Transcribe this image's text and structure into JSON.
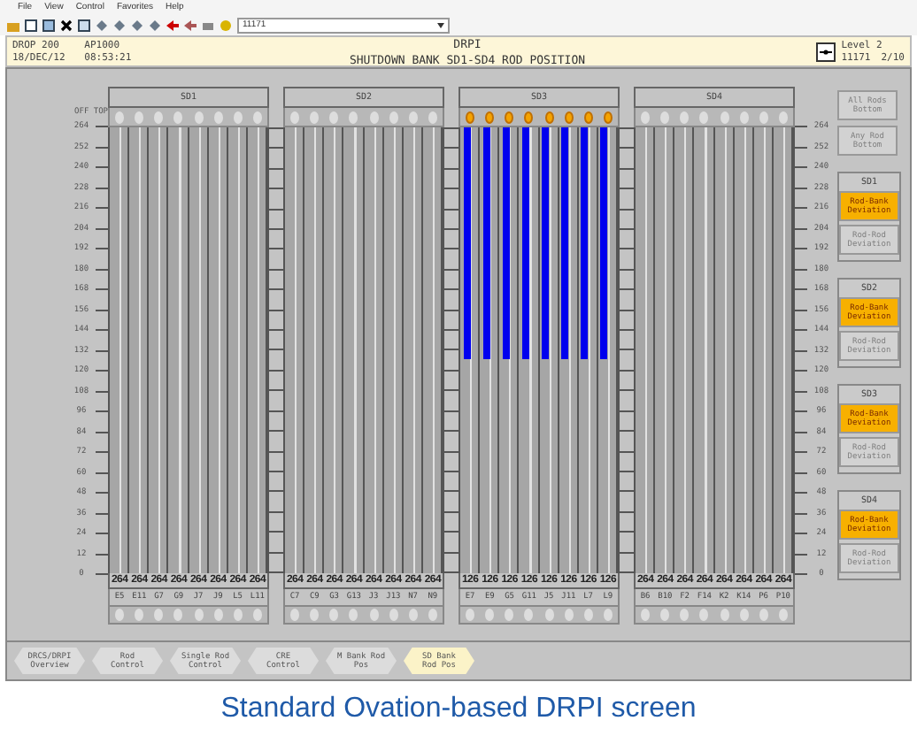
{
  "menu": [
    "File",
    "View",
    "Control",
    "Favorites",
    "Help"
  ],
  "toolbar": {
    "field_value": "11171"
  },
  "header": {
    "drop": "DROP 200",
    "node": "AP1000",
    "date": "18/DEC/12",
    "time": "08:53:21",
    "title": "DRPI",
    "subtitle": "SHUTDOWN BANK SD1-SD4 ROD POSITION",
    "level": "Level 2",
    "point": "11171",
    "page": "2/10"
  },
  "scale": {
    "top_label": "OFF TOP",
    "right_ticks": [
      "264",
      "252",
      "240",
      "228",
      "216",
      "204",
      "192",
      "180",
      "168",
      "156",
      "144",
      "132",
      "120",
      "108",
      "96",
      "84",
      "72",
      "60",
      "48",
      "36",
      "24",
      "12",
      "0"
    ],
    "ticks": [
      "264",
      "252",
      "240",
      "228",
      "216",
      "204",
      "192",
      "180",
      "168",
      "156",
      "144",
      "132",
      "120",
      "108",
      "96",
      "84",
      "72",
      "60",
      "48",
      "36",
      "24",
      "12",
      "0"
    ]
  },
  "banks": [
    {
      "name": "SD1",
      "rods": [
        {
          "id": "E5",
          "value": "264",
          "lit": false
        },
        {
          "id": "E11",
          "value": "264",
          "lit": false
        },
        {
          "id": "G7",
          "value": "264",
          "lit": false
        },
        {
          "id": "G9",
          "value": "264",
          "lit": false
        },
        {
          "id": "J7",
          "value": "264",
          "lit": false
        },
        {
          "id": "J9",
          "value": "264",
          "lit": false
        },
        {
          "id": "L5",
          "value": "264",
          "lit": false
        },
        {
          "id": "L11",
          "value": "264",
          "lit": false
        }
      ]
    },
    {
      "name": "SD2",
      "rods": [
        {
          "id": "C7",
          "value": "264",
          "lit": false
        },
        {
          "id": "C9",
          "value": "264",
          "lit": false
        },
        {
          "id": "G3",
          "value": "264",
          "lit": false
        },
        {
          "id": "G13",
          "value": "264",
          "lit": false
        },
        {
          "id": "J3",
          "value": "264",
          "lit": false
        },
        {
          "id": "J13",
          "value": "264",
          "lit": false
        },
        {
          "id": "N7",
          "value": "264",
          "lit": false
        },
        {
          "id": "N9",
          "value": "264",
          "lit": false
        }
      ]
    },
    {
      "name": "SD3",
      "rods": [
        {
          "id": "E7",
          "value": "126",
          "level": 0.52,
          "lit": true
        },
        {
          "id": "E9",
          "value": "126",
          "level": 0.52,
          "lit": true
        },
        {
          "id": "G5",
          "value": "126",
          "level": 0.52,
          "lit": true
        },
        {
          "id": "G11",
          "value": "126",
          "level": 0.52,
          "lit": true
        },
        {
          "id": "J5",
          "value": "126",
          "level": 0.52,
          "lit": true
        },
        {
          "id": "J11",
          "value": "126",
          "level": 0.52,
          "lit": true
        },
        {
          "id": "L7",
          "value": "126",
          "level": 0.52,
          "lit": true
        },
        {
          "id": "L9",
          "value": "126",
          "level": 0.52,
          "lit": true
        }
      ]
    },
    {
      "name": "SD4",
      "rods": [
        {
          "id": "B6",
          "value": "264",
          "lit": false
        },
        {
          "id": "B10",
          "value": "264",
          "lit": false
        },
        {
          "id": "F2",
          "value": "264",
          "lit": false
        },
        {
          "id": "F14",
          "value": "264",
          "lit": false
        },
        {
          "id": "K2",
          "value": "264",
          "lit": false
        },
        {
          "id": "K14",
          "value": "264",
          "lit": false
        },
        {
          "id": "P6",
          "value": "264",
          "lit": false
        },
        {
          "id": "P10",
          "value": "264",
          "lit": false
        }
      ]
    }
  ],
  "status": {
    "buttons": [
      {
        "label": "All Rods Bottom",
        "active": false
      },
      {
        "label": "Any Rod Bottom",
        "active": false
      }
    ],
    "groups": [
      {
        "name": "SD1",
        "alarms": [
          {
            "label": "Rod-Bank Deviation",
            "active": true
          },
          {
            "label": "Rod-Rod Deviation",
            "active": false
          }
        ]
      },
      {
        "name": "SD2",
        "alarms": [
          {
            "label": "Rod-Bank Deviation",
            "active": true
          },
          {
            "label": "Rod-Rod Deviation",
            "active": false
          }
        ]
      },
      {
        "name": "SD3",
        "alarms": [
          {
            "label": "Rod-Bank Deviation",
            "active": true
          },
          {
            "label": "Rod-Rod Deviation",
            "active": false
          }
        ]
      },
      {
        "name": "SD4",
        "alarms": [
          {
            "label": "Rod-Bank Deviation",
            "active": true
          },
          {
            "label": "Rod-Rod Deviation",
            "active": false
          }
        ]
      }
    ]
  },
  "nav": [
    {
      "label": "DRCS/DRPI Overview",
      "selected": false
    },
    {
      "label": "Rod Control",
      "selected": false
    },
    {
      "label": "Single Rod Control",
      "selected": false
    },
    {
      "label": "CRE Control",
      "selected": false
    },
    {
      "label": "M Bank Rod Pos",
      "selected": false
    },
    {
      "label": "SD Bank Rod Pos",
      "selected": true
    }
  ],
  "caption": "Standard Ovation-based DRPI screen"
}
